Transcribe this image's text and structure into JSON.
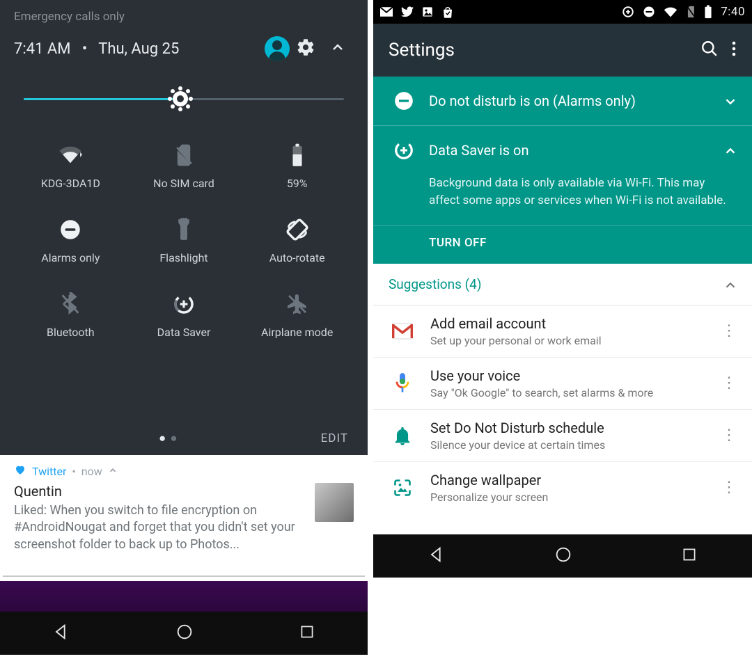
{
  "left": {
    "emergency": "Emergency calls only",
    "time": "7:41 AM",
    "date_sep": "•",
    "date": "Thu, Aug 25",
    "tiles": [
      {
        "label": "KDG-3DA1D",
        "active": true
      },
      {
        "label": "No SIM card",
        "active": false
      },
      {
        "label": "59%",
        "active": true
      },
      {
        "label": "Alarms only",
        "active": true
      },
      {
        "label": "Flashlight",
        "active": false
      },
      {
        "label": "Auto-rotate",
        "active": true
      },
      {
        "label": "Bluetooth",
        "active": false
      },
      {
        "label": "Data Saver",
        "active": true
      },
      {
        "label": "Airplane mode",
        "active": false
      }
    ],
    "edit": "EDIT",
    "notif": {
      "app": "Twitter",
      "time": "now",
      "title": "Quentin",
      "body": "Liked: When you switch to file encryption on #AndroidNougat and forget that you didn't set your screenshot folder to back up to Photos..."
    }
  },
  "right": {
    "clock": "7:40",
    "appbar_title": "Settings",
    "banners": {
      "dnd": "Do not disturb is on (Alarms only)",
      "ds_title": "Data Saver is on",
      "ds_body": "Background data is only available via Wi-Fi. This may affect some apps or services when Wi-Fi is not available.",
      "ds_action": "TURN OFF"
    },
    "suggestions_header": "Suggestions (4)",
    "suggestions": [
      {
        "title": "Add email account",
        "sub": "Set up your personal or work email"
      },
      {
        "title": "Use your voice",
        "sub": "Say \"Ok Google\" to search, set alarms & more"
      },
      {
        "title": "Set Do Not Disturb schedule",
        "sub": "Silence your device at certain times"
      },
      {
        "title": "Change wallpaper",
        "sub": "Personalize your screen"
      }
    ]
  }
}
